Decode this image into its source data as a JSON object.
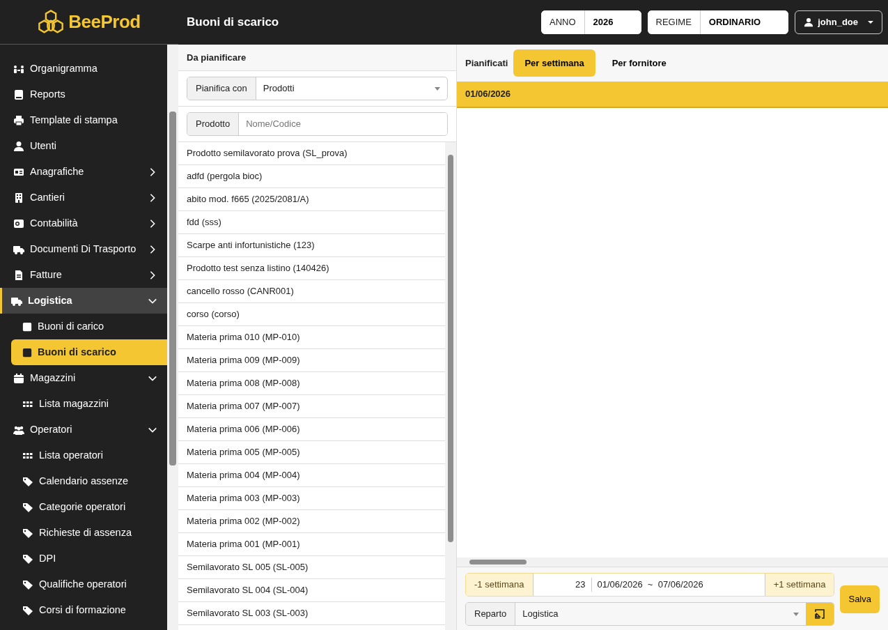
{
  "brand": "BeeProd",
  "page_title": "Buoni di scarico",
  "header": {
    "year_label": "ANNO",
    "year": "2026",
    "regime_label": "REGIME",
    "regime": "ORDINARIO",
    "user": "john_doe"
  },
  "sidebar": {
    "items": [
      {
        "label": "Organigramma",
        "kind": "link",
        "selected": false
      },
      {
        "label": "Reports",
        "kind": "link",
        "selected": false
      },
      {
        "label": "Template di stampa",
        "kind": "link",
        "selected": false
      },
      {
        "label": "Utenti",
        "kind": "link",
        "selected": false
      },
      {
        "label": "Anagrafiche",
        "kind": "group",
        "selected": false,
        "expanded": false
      },
      {
        "label": "Cantieri",
        "kind": "group",
        "selected": false,
        "expanded": false
      },
      {
        "label": "Contabilità",
        "kind": "group",
        "selected": false,
        "expanded": false
      },
      {
        "label": "Documenti Di Trasporto",
        "kind": "group",
        "selected": false,
        "expanded": false
      },
      {
        "label": "Fatture",
        "kind": "group",
        "selected": false,
        "expanded": false
      },
      {
        "label": "Logistica",
        "kind": "group",
        "selected": true,
        "expanded": true,
        "children": [
          {
            "label": "Buoni di carico",
            "selected": false
          },
          {
            "label": "Buoni di scarico",
            "selected": true
          }
        ]
      },
      {
        "label": "Magazzini",
        "kind": "group",
        "selected": false,
        "expanded": true,
        "children": [
          {
            "label": "Lista magazzini",
            "selected": false
          }
        ]
      },
      {
        "label": "Operatori",
        "kind": "group",
        "selected": false,
        "expanded": true,
        "children": [
          {
            "label": "Lista operatori",
            "selected": false
          },
          {
            "label": "Calendario assenze",
            "selected": false
          },
          {
            "label": "Categorie operatori",
            "selected": false
          },
          {
            "label": "Richieste di assenza",
            "selected": false
          },
          {
            "label": "DPI",
            "selected": false
          },
          {
            "label": "Qualifiche operatori",
            "selected": false
          },
          {
            "label": "Corsi di formazione",
            "selected": false
          }
        ]
      }
    ]
  },
  "left_panel": {
    "title": "Da pianificare",
    "plan_label": "Pianifica con",
    "plan_value": "Prodotti",
    "product_label": "Prodotto",
    "product_placeholder": "Nome/Codice",
    "products": [
      "Prodotto semilavorato prova (SL_prova)",
      "adfd (pergola bioc)",
      "abito mod. f665 (2025/2081/A)",
      "fdd (sss)",
      "Scarpe anti infortunistiche (123)",
      "Prodotto test senza listino (140426)",
      "cancello rosso (CANR001)",
      "corso (corso)",
      "Materia prima 010 (MP-010)",
      "Materia prima 009 (MP-009)",
      "Materia prima 008 (MP-008)",
      "Materia prima 007 (MP-007)",
      "Materia prima 006 (MP-006)",
      "Materia prima 005 (MP-005)",
      "Materia prima 004 (MP-004)",
      "Materia prima 003 (MP-003)",
      "Materia prima 002 (MP-002)",
      "Materia prima 001 (MP-001)",
      "Semilavorato SL 005 (SL-005)",
      "Semilavorato SL 004 (SL-004)",
      "Semilavorato SL 003 (SL-003)"
    ]
  },
  "right_panel": {
    "label": "Pianificati",
    "tabs": [
      {
        "label": "Per settimana",
        "selected": true
      },
      {
        "label": "Per fornitore",
        "selected": false
      }
    ],
    "date_header": "01/06/2026",
    "prev_week": "-1 settimana",
    "week_number": "23",
    "week_range": "01/06/2026  ~  07/06/2026",
    "next_week": "+1 settimana",
    "department_label": "Reparto",
    "department": "Logistica",
    "save": "Salva"
  }
}
